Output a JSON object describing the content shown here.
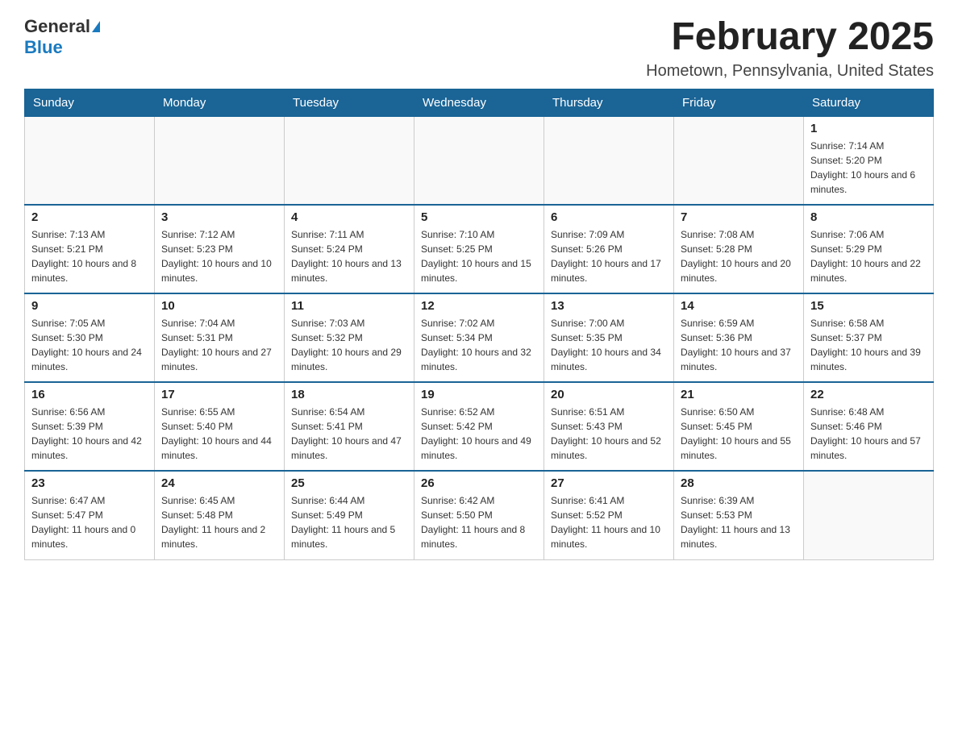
{
  "logo": {
    "general": "General",
    "blue": "Blue"
  },
  "title": "February 2025",
  "location": "Hometown, Pennsylvania, United States",
  "days_of_week": [
    "Sunday",
    "Monday",
    "Tuesday",
    "Wednesday",
    "Thursday",
    "Friday",
    "Saturday"
  ],
  "weeks": [
    [
      {
        "day": "",
        "info": ""
      },
      {
        "day": "",
        "info": ""
      },
      {
        "day": "",
        "info": ""
      },
      {
        "day": "",
        "info": ""
      },
      {
        "day": "",
        "info": ""
      },
      {
        "day": "",
        "info": ""
      },
      {
        "day": "1",
        "info": "Sunrise: 7:14 AM\nSunset: 5:20 PM\nDaylight: 10 hours and 6 minutes."
      }
    ],
    [
      {
        "day": "2",
        "info": "Sunrise: 7:13 AM\nSunset: 5:21 PM\nDaylight: 10 hours and 8 minutes."
      },
      {
        "day": "3",
        "info": "Sunrise: 7:12 AM\nSunset: 5:23 PM\nDaylight: 10 hours and 10 minutes."
      },
      {
        "day": "4",
        "info": "Sunrise: 7:11 AM\nSunset: 5:24 PM\nDaylight: 10 hours and 13 minutes."
      },
      {
        "day": "5",
        "info": "Sunrise: 7:10 AM\nSunset: 5:25 PM\nDaylight: 10 hours and 15 minutes."
      },
      {
        "day": "6",
        "info": "Sunrise: 7:09 AM\nSunset: 5:26 PM\nDaylight: 10 hours and 17 minutes."
      },
      {
        "day": "7",
        "info": "Sunrise: 7:08 AM\nSunset: 5:28 PM\nDaylight: 10 hours and 20 minutes."
      },
      {
        "day": "8",
        "info": "Sunrise: 7:06 AM\nSunset: 5:29 PM\nDaylight: 10 hours and 22 minutes."
      }
    ],
    [
      {
        "day": "9",
        "info": "Sunrise: 7:05 AM\nSunset: 5:30 PM\nDaylight: 10 hours and 24 minutes."
      },
      {
        "day": "10",
        "info": "Sunrise: 7:04 AM\nSunset: 5:31 PM\nDaylight: 10 hours and 27 minutes."
      },
      {
        "day": "11",
        "info": "Sunrise: 7:03 AM\nSunset: 5:32 PM\nDaylight: 10 hours and 29 minutes."
      },
      {
        "day": "12",
        "info": "Sunrise: 7:02 AM\nSunset: 5:34 PM\nDaylight: 10 hours and 32 minutes."
      },
      {
        "day": "13",
        "info": "Sunrise: 7:00 AM\nSunset: 5:35 PM\nDaylight: 10 hours and 34 minutes."
      },
      {
        "day": "14",
        "info": "Sunrise: 6:59 AM\nSunset: 5:36 PM\nDaylight: 10 hours and 37 minutes."
      },
      {
        "day": "15",
        "info": "Sunrise: 6:58 AM\nSunset: 5:37 PM\nDaylight: 10 hours and 39 minutes."
      }
    ],
    [
      {
        "day": "16",
        "info": "Sunrise: 6:56 AM\nSunset: 5:39 PM\nDaylight: 10 hours and 42 minutes."
      },
      {
        "day": "17",
        "info": "Sunrise: 6:55 AM\nSunset: 5:40 PM\nDaylight: 10 hours and 44 minutes."
      },
      {
        "day": "18",
        "info": "Sunrise: 6:54 AM\nSunset: 5:41 PM\nDaylight: 10 hours and 47 minutes."
      },
      {
        "day": "19",
        "info": "Sunrise: 6:52 AM\nSunset: 5:42 PM\nDaylight: 10 hours and 49 minutes."
      },
      {
        "day": "20",
        "info": "Sunrise: 6:51 AM\nSunset: 5:43 PM\nDaylight: 10 hours and 52 minutes."
      },
      {
        "day": "21",
        "info": "Sunrise: 6:50 AM\nSunset: 5:45 PM\nDaylight: 10 hours and 55 minutes."
      },
      {
        "day": "22",
        "info": "Sunrise: 6:48 AM\nSunset: 5:46 PM\nDaylight: 10 hours and 57 minutes."
      }
    ],
    [
      {
        "day": "23",
        "info": "Sunrise: 6:47 AM\nSunset: 5:47 PM\nDaylight: 11 hours and 0 minutes."
      },
      {
        "day": "24",
        "info": "Sunrise: 6:45 AM\nSunset: 5:48 PM\nDaylight: 11 hours and 2 minutes."
      },
      {
        "day": "25",
        "info": "Sunrise: 6:44 AM\nSunset: 5:49 PM\nDaylight: 11 hours and 5 minutes."
      },
      {
        "day": "26",
        "info": "Sunrise: 6:42 AM\nSunset: 5:50 PM\nDaylight: 11 hours and 8 minutes."
      },
      {
        "day": "27",
        "info": "Sunrise: 6:41 AM\nSunset: 5:52 PM\nDaylight: 11 hours and 10 minutes."
      },
      {
        "day": "28",
        "info": "Sunrise: 6:39 AM\nSunset: 5:53 PM\nDaylight: 11 hours and 13 minutes."
      },
      {
        "day": "",
        "info": ""
      }
    ]
  ]
}
